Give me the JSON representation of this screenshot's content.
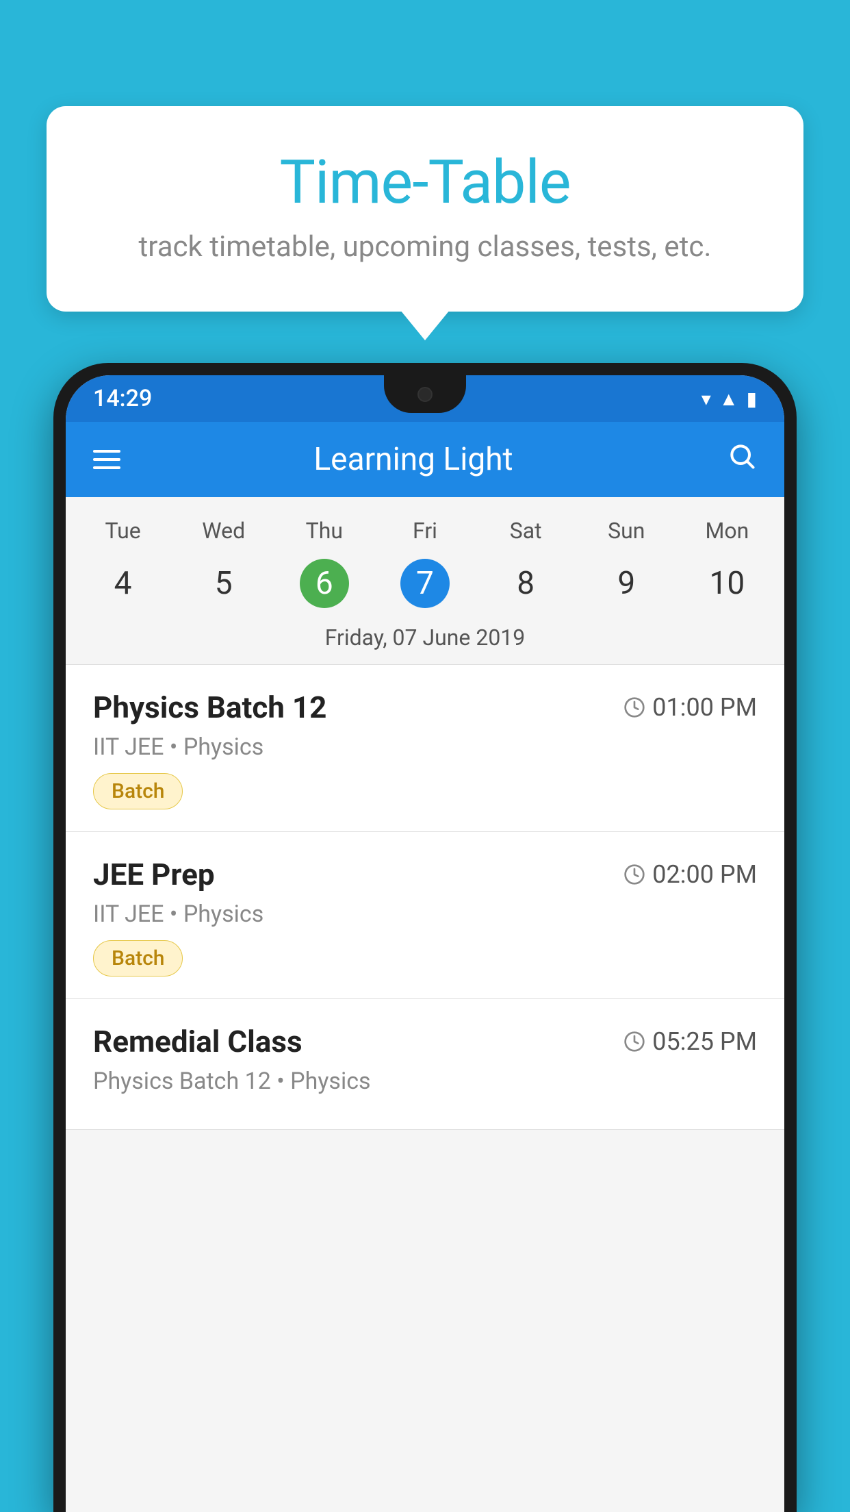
{
  "background_color": "#29b6d8",
  "tooltip": {
    "title": "Time-Table",
    "subtitle": "track timetable, upcoming classes, tests, etc."
  },
  "phone": {
    "status_bar": {
      "time": "14:29",
      "icons": [
        "wifi",
        "signal",
        "battery"
      ]
    },
    "toolbar": {
      "app_name": "Learning Light",
      "menu_label": "menu",
      "search_label": "search"
    },
    "calendar": {
      "days": [
        {
          "name": "Tue",
          "num": "4",
          "state": "normal"
        },
        {
          "name": "Wed",
          "num": "5",
          "state": "normal"
        },
        {
          "name": "Thu",
          "num": "6",
          "state": "today"
        },
        {
          "name": "Fri",
          "num": "7",
          "state": "selected"
        },
        {
          "name": "Sat",
          "num": "8",
          "state": "normal"
        },
        {
          "name": "Sun",
          "num": "9",
          "state": "normal"
        },
        {
          "name": "Mon",
          "num": "10",
          "state": "normal"
        }
      ],
      "selected_date_label": "Friday, 07 June 2019"
    },
    "schedule": [
      {
        "title": "Physics Batch 12",
        "time": "01:00 PM",
        "subtitle": "IIT JEE • Physics",
        "badge": "Batch"
      },
      {
        "title": "JEE Prep",
        "time": "02:00 PM",
        "subtitle": "IIT JEE • Physics",
        "badge": "Batch"
      },
      {
        "title": "Remedial Class",
        "time": "05:25 PM",
        "subtitle": "Physics Batch 12 • Physics",
        "badge": null
      }
    ]
  }
}
